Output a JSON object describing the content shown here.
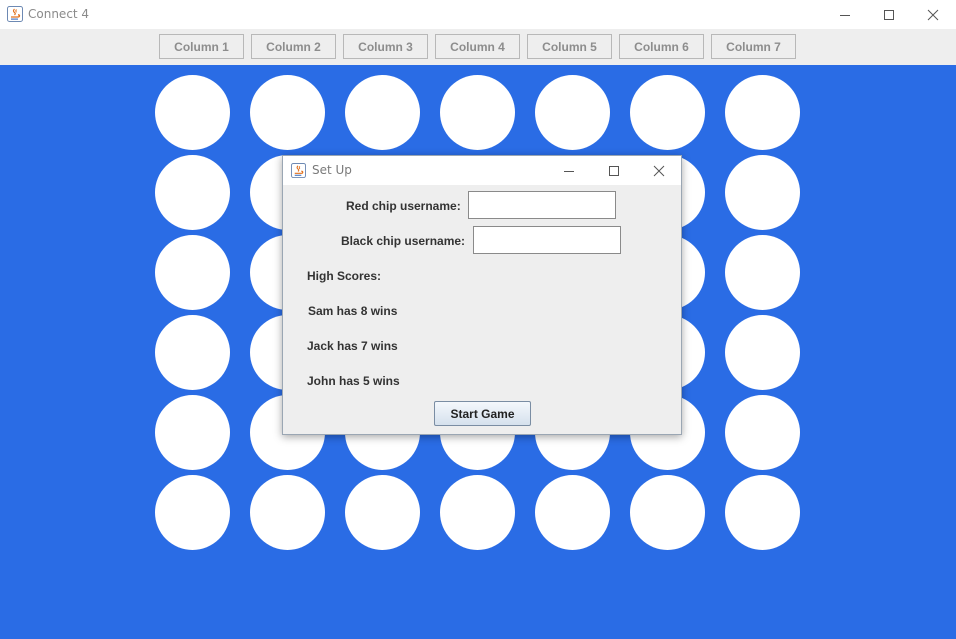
{
  "window": {
    "title": "Connect 4"
  },
  "toolbar": {
    "columns": [
      "Column 1",
      "Column 2",
      "Column 3",
      "Column 4",
      "Column 5",
      "Column 6",
      "Column 7"
    ]
  },
  "board": {
    "rows": 6,
    "cols": 7,
    "color": "#2a6ce5",
    "empty_slot_color": "#ffffff"
  },
  "dialog": {
    "title": "Set Up",
    "red_label": "Red chip username:",
    "red_value": "",
    "black_label": "Black chip username:",
    "black_value": "",
    "high_scores_label": "High Scores:",
    "scores": [
      "Sam has 8 wins",
      "Jack has 7 wins",
      "John has 5 wins"
    ],
    "start_label": "Start Game"
  }
}
